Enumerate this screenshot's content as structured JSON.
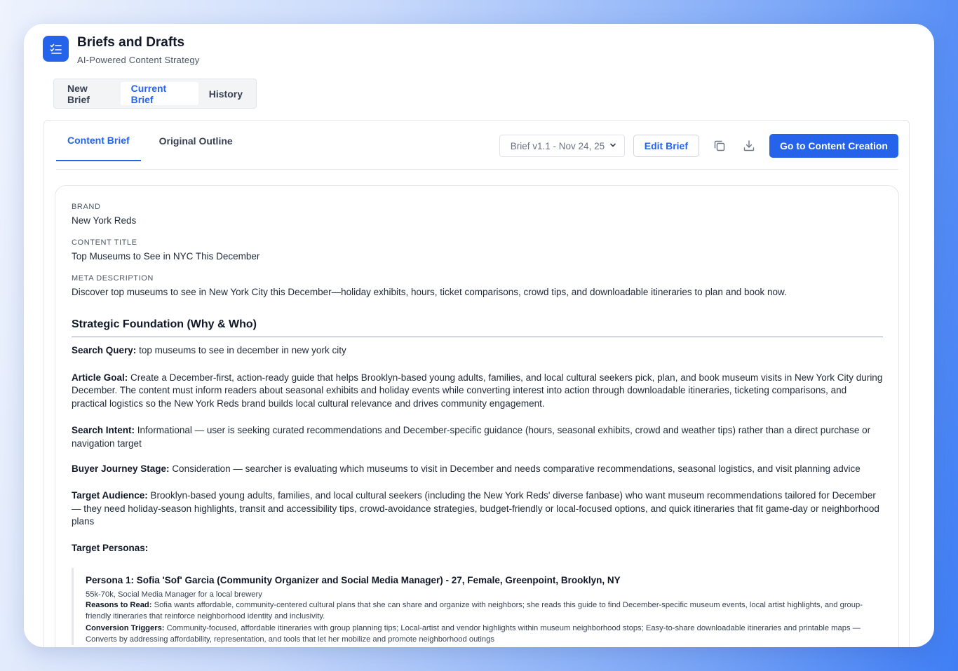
{
  "app": {
    "title": "Briefs and Drafts",
    "subtitle": "AI-Powered Content Strategy",
    "accent": "#2563eb"
  },
  "main_tabs": [
    {
      "label": "New Brief",
      "active": false
    },
    {
      "label": "Current Brief",
      "active": true
    },
    {
      "label": "History",
      "active": false
    }
  ],
  "sub_tabs": [
    {
      "label": "Content Brief",
      "active": true
    },
    {
      "label": "Original Outline",
      "active": false
    }
  ],
  "toolbar": {
    "version_selected": "Brief v1.1 - Nov 24, 25",
    "edit_label": "Edit Brief",
    "copy_icon": "copy-icon",
    "download_icon": "download-icon",
    "primary_label": "Go to Content Creation"
  },
  "brief": {
    "brand_label": "BRAND",
    "brand_value": "New York Reds",
    "title_label": "CONTENT TITLE",
    "title_value": "Top Museums to See in NYC This December",
    "meta_label": "META DESCRIPTION",
    "meta_value": "Discover top museums to see in New York City this December—holiday exhibits, hours, ticket comparisons, crowd tips, and downloadable itineraries to plan and book now.",
    "section_title": "Strategic Foundation (Why & Who)",
    "search_query_label": "Search Query:",
    "search_query_value": "top museums to see in december in new york city",
    "article_goal_label": "Article Goal:",
    "article_goal_value": "Create a December-first, action-ready guide that helps Brooklyn-based young adults, families, and local cultural seekers pick, plan, and book museum visits in New York City during December. The content must inform readers about seasonal exhibits and holiday events while converting interest into action through downloadable itineraries, ticketing comparisons, and practical logistics so the New York Reds brand builds local cultural relevance and drives community engagement.",
    "search_intent_label": "Search Intent:",
    "search_intent_value": "Informational — user is seeking curated recommendations and December-specific guidance (hours, seasonal exhibits, crowd and weather tips) rather than a direct purchase or navigation target",
    "journey_label": "Buyer Journey Stage:",
    "journey_value": "Consideration — searcher is evaluating which museums to visit in December and needs comparative recommendations, seasonal logistics, and visit planning advice",
    "audience_label": "Target Audience:",
    "audience_value": "Brooklyn-based young adults, families, and local cultural seekers (including the New York Reds' diverse fanbase) who want museum recommendations tailored for December — they need holiday-season highlights, transit and accessibility tips, crowd-avoidance strategies, budget-friendly or local-focused options, and quick itineraries that fit game-day or neighborhood plans",
    "personas_label": "Target Personas:",
    "persona1": {
      "title": "Persona 1: Sofia 'Sof' Garcia (Community Organizer and Social Media Manager) - 27, Female, Greenpoint, Brooklyn, NY",
      "income": "55k-70k, Social Media Manager for a local brewery",
      "reasons_label": "Reasons to Read:",
      "reasons_value": "Sofia wants affordable, community-centered cultural plans that she can share and organize with neighbors; she reads this guide to find December-specific museum events, local artist highlights, and group-friendly itineraries that reinforce neighborhood identity and inclusivity.",
      "triggers_label": "Conversion Triggers:",
      "triggers_value": "Community-focused, affordable itineraries with group planning tips; Local-artist and vendor highlights within museum neighborhood stops; Easy-to-share downloadable itineraries and printable maps — Converts by addressing affordability, representation, and tools that let her mobilize and promote neighborhood outings"
    }
  }
}
